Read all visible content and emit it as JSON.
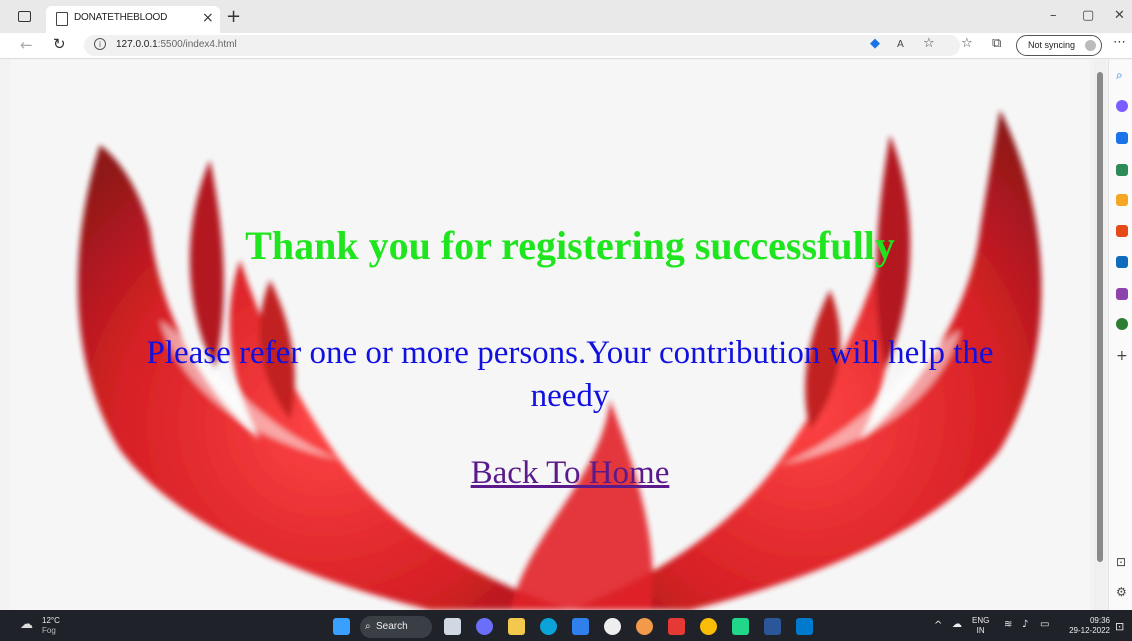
{
  "browser": {
    "tab_title": "DONATETHEBLOOD",
    "url_host": "127.0.0.1",
    "url_path": ":5500/index4.html",
    "sync_label": "Not syncing"
  },
  "page": {
    "headline": "Thank you for registering successfully",
    "message": "Please refer one or more persons.Your contribution will help the needy",
    "home_link": "Back To Home"
  },
  "taskbar": {
    "weather_temp": "12°C",
    "weather_desc": "Fog",
    "search_label": "Search",
    "lang": "ENG",
    "region": "IN",
    "time": "09:36",
    "date": "29-12-2022"
  },
  "colors": {
    "headline": "#1fe51f",
    "message": "#1010e0",
    "link": "#5a1a8c",
    "hands": "#d4141a"
  }
}
